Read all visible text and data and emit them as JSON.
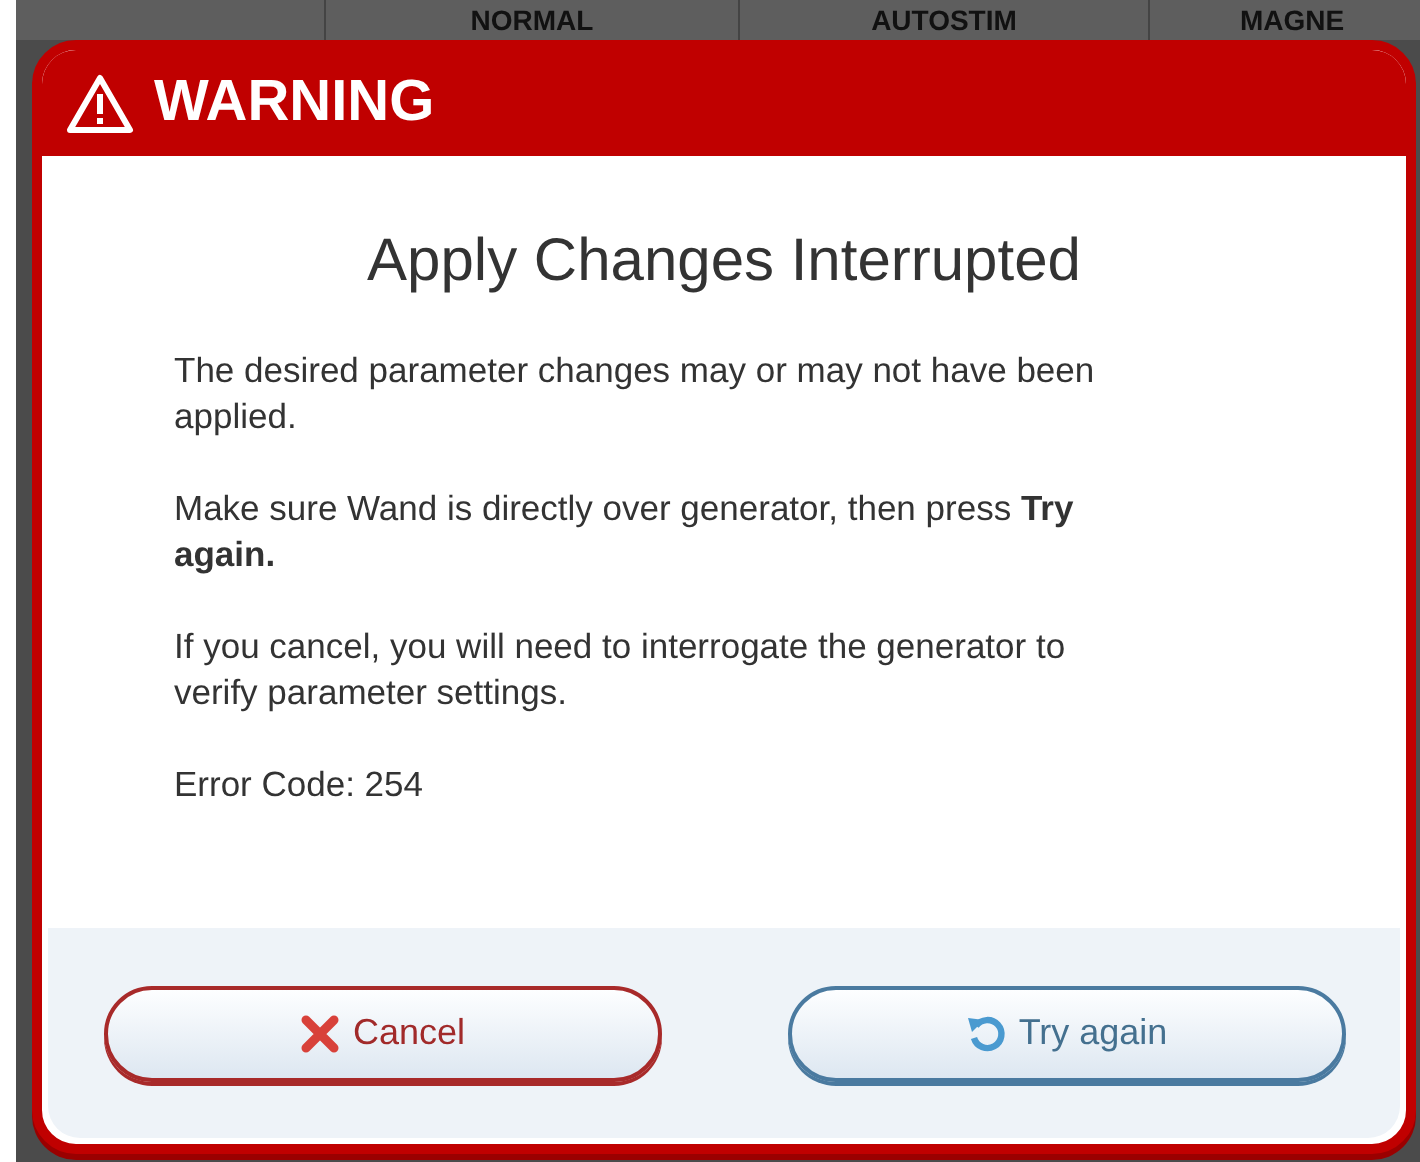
{
  "background": {
    "columns": [
      "NORMAL",
      "AUTOSTIM",
      "MAGNE"
    ]
  },
  "dialog": {
    "header": "WARNING",
    "title": "Apply Changes Interrupted",
    "paragraphs": [
      "The desired parameter changes may or may not have been applied.",
      "Make sure Wand is directly over generator, then press **Try again.**",
      "If you cancel, you will need to interrogate the generator to verify parameter settings.",
      "Error Code: 254"
    ],
    "buttons": [
      {
        "kind": "cancel",
        "label": "Cancel"
      },
      {
        "kind": "retry",
        "label": "Try again"
      }
    ]
  }
}
